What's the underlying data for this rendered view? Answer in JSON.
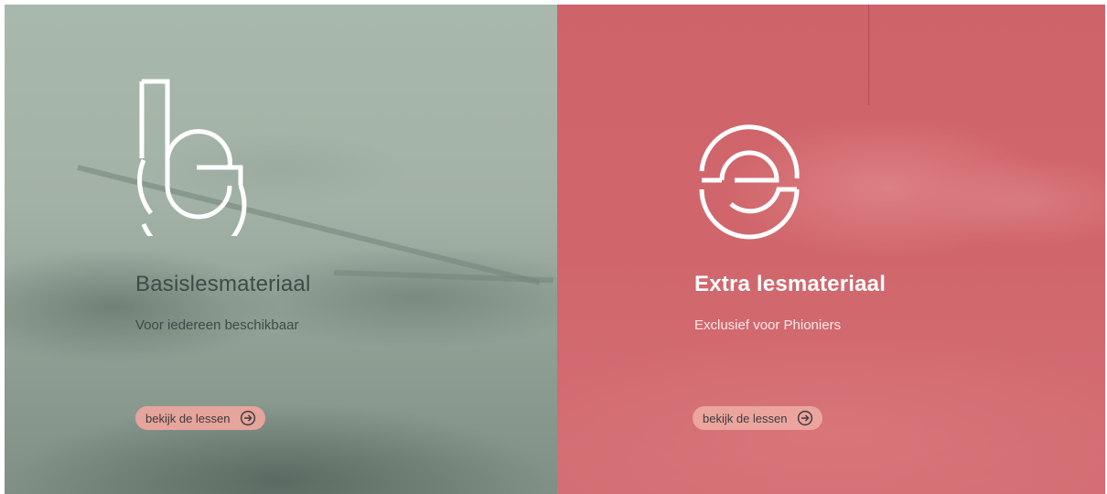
{
  "panels": {
    "basis": {
      "title": "Basislesmateriaal",
      "subtitle": "Voor iedereen beschikbaar",
      "button_label": "bekijk de lessen",
      "logo_icon": "b-letter-logo-icon",
      "background_color": "#a3b3a7"
    },
    "extra": {
      "title": "Extra lesmateriaal",
      "subtitle": "Exclusief voor Phioniers",
      "button_label": "bekijk de lessen",
      "logo_icon": "e-letter-logo-icon",
      "background_color": "#d1656c"
    }
  },
  "button_icon": "arrow-right-circle-icon",
  "button_color": "#e5a49c"
}
